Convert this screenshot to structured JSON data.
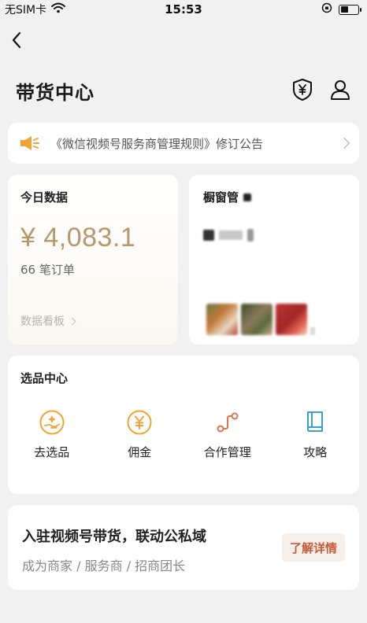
{
  "status_bar": {
    "carrier": "无SIM卡",
    "time": "15:53"
  },
  "header": {
    "title": "带货中心",
    "icons": [
      "back-arrow-icon",
      "shield-yen-icon",
      "person-icon"
    ]
  },
  "notice": {
    "icon": "megaphone-icon",
    "text": "《微信视频号服务商管理规则》修订公告"
  },
  "today_data": {
    "title": "今日数据",
    "amount": "¥ 4,083.1",
    "orders": "66 笔订单",
    "dashboard_link": "数据看板"
  },
  "showcase": {
    "title": "橱窗管"
  },
  "selection_center": {
    "title": "选品中心",
    "items": [
      {
        "label": "去选品",
        "icon": "hand-star-icon"
      },
      {
        "label": "佣金",
        "icon": "yen-circle-icon"
      },
      {
        "label": "合作管理",
        "icon": "connect-nodes-icon"
      },
      {
        "label": "攻略",
        "icon": "book-icon"
      }
    ]
  },
  "promo": {
    "title": "入驻视频号带货，联动公私域",
    "subtitle": "成为商家 / 服务商 / 招商团长",
    "button": "了解详情"
  },
  "colors": {
    "accent_gold": "#b6986a",
    "accent_orange": "#f0a436",
    "promo_button_text": "#c85a3c",
    "book_blue": "#3d9bd6"
  }
}
